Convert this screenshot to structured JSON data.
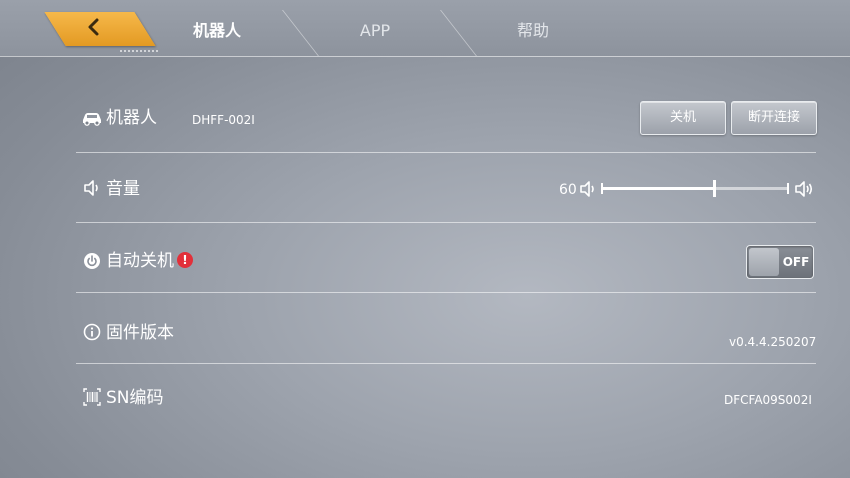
{
  "tabs": {
    "back_icon": "chevron-left-icon",
    "items": [
      {
        "label": "机器人",
        "active": true
      },
      {
        "label": "APP",
        "active": false
      },
      {
        "label": "帮助",
        "active": false
      }
    ]
  },
  "robot": {
    "icon": "car-icon",
    "label": "机器人",
    "name": "DHFF-002I",
    "shutdown_label": "关机",
    "disconnect_label": "断开连接"
  },
  "volume": {
    "icon": "speaker-icon",
    "label": "音量",
    "value": "60",
    "level": 0.6
  },
  "auto_shutdown": {
    "icon": "power-icon",
    "label": "自动关机",
    "warning": "!",
    "toggle_label": "OFF",
    "enabled": false
  },
  "firmware": {
    "icon": "info-icon",
    "label": "固件版本",
    "value": "v0.4.4.250207"
  },
  "sn": {
    "icon": "barcode-icon",
    "label": "SN编码",
    "value": "DFCFA09S002I"
  },
  "colors": {
    "accent": "#f0a93a",
    "warning": "#e2303a",
    "background": "#9da3ad"
  }
}
